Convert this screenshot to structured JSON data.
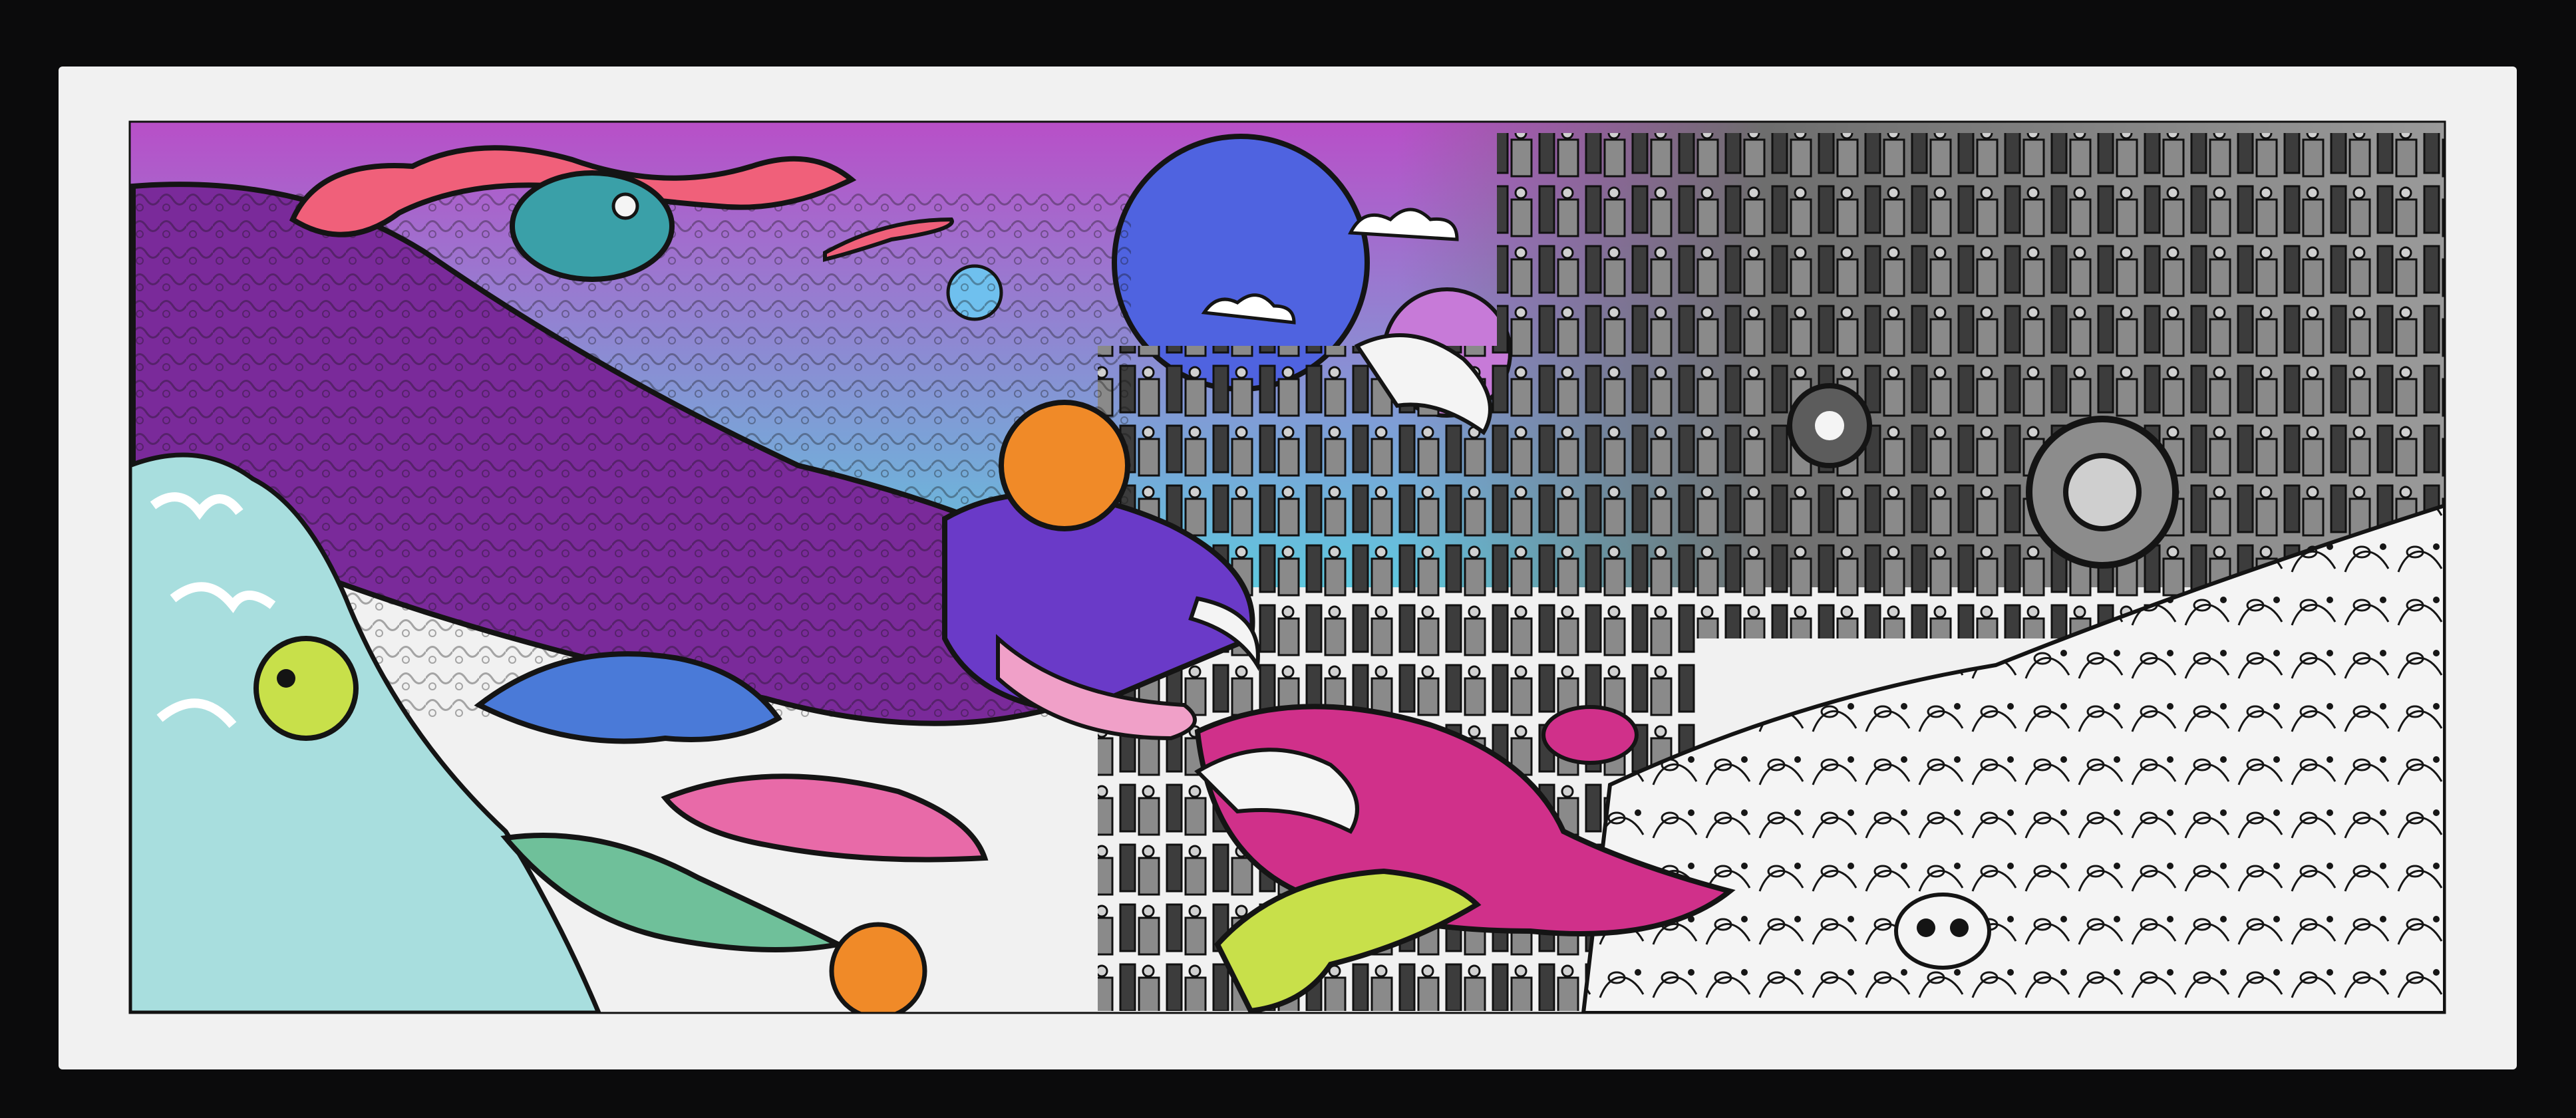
{
  "photo": {
    "subject": "framed-art-print",
    "style": "psychedelic-line-art-panorama",
    "colors": {
      "backdrop": "#0b0b0c",
      "mat": "#f1f1f1",
      "sky_top": "#b84fc8",
      "sky_bottom": "#5fc8de",
      "moon": "#4f63e0",
      "small_moon": "#6fc0ee",
      "pink_planet": "#c77ad8",
      "beast_purple": "#7a2a9a",
      "beast_head": "#6a3ac8",
      "serpent_pink": "#f0607a",
      "wave_teal": "#a8dede",
      "city_grey": "#6e6e6e",
      "ink": "#141414",
      "lineart_white": "#f4f4f4",
      "lime": "#c8e04a",
      "magenta": "#d0308a",
      "orange": "#f08a28"
    }
  }
}
